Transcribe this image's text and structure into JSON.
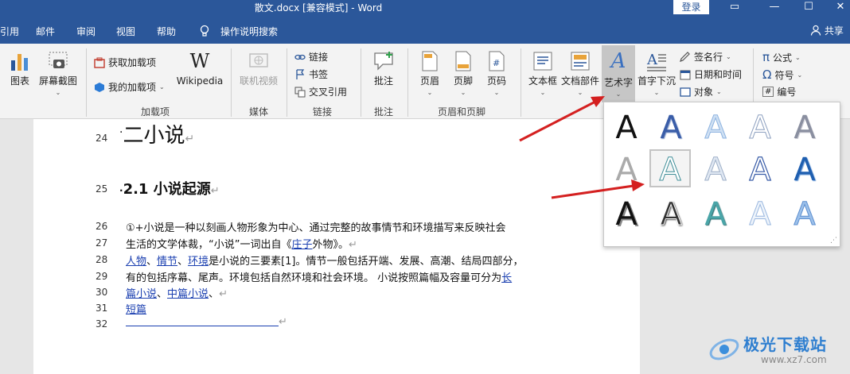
{
  "window": {
    "title": "散文.docx [兼容模式]  -  Word",
    "login": "登录",
    "btn_ribbon": "▭",
    "btn_min": "—",
    "btn_max": "☐",
    "btn_close": "✕"
  },
  "menu": {
    "items": [
      "引用",
      "邮件",
      "审阅",
      "视图",
      "帮助"
    ],
    "tell_me": "操作说明搜索",
    "share": "共享"
  },
  "ribbon": {
    "chart": "图表",
    "screenshot": "屏幕截图",
    "get_addins": "获取加载项",
    "my_addins": "我的加载项",
    "wikipedia": "Wikipedia",
    "addins_group": "加载项",
    "online_video": "联机视频",
    "media_group": "媒体",
    "link": "链接",
    "bookmark": "书签",
    "crossref": "交叉引用",
    "links_group": "链接",
    "comment": "批注",
    "comment_group": "批注",
    "header": "页眉",
    "footer": "页脚",
    "page_number": "页码",
    "hf_group": "页眉和页脚",
    "textbox": "文本框",
    "doc_parts": "文档部件",
    "wordart": "艺术字",
    "dropcap": "首字下沉",
    "sigline": "签名行",
    "datetime": "日期和时间",
    "object": "对象",
    "equation": "公式",
    "symbol": "符号",
    "numbering": "编号",
    "wordart_glyph": "A",
    "wiki_glyph": "W",
    "eq_glyph": "π",
    "sym_glyph": "Ω",
    "num_glyph": "#"
  },
  "document": {
    "line_numbers": [
      "24",
      "25",
      "26",
      "27",
      "28",
      "29",
      "30",
      "31",
      "32"
    ],
    "h1": "二小说",
    "h2": "2.1 小说起源",
    "p1": "①+小说是一种以刻画人物形象为中心、通过完整的故事情节和环境描写来反映社会",
    "p2a": "生活的文学体裁，“小说”一词出自《",
    "p2link": "庄子",
    "p2b": "外物》。",
    "p3l1": "人物",
    "p3s1": "、",
    "p3l2": "情节",
    "p3s2": "、",
    "p3l3": "环境",
    "p3b": "是小说的三要素[1]。情节一般包括开端、发展、高潮、结局四部分，",
    "p4a": "有的包括序幕、尾声。环境包括自然环境和社会环境。 小说按照篇幅及容量可分为",
    "p4link": "长",
    "p5link1": "篇小说",
    "p5s": "、",
    "p5link2": "中篇小说",
    "p5b": "、",
    "p6link": "短篇",
    "ret": "↵"
  },
  "gallery": {
    "glyph": "A",
    "count": 15,
    "selected": 6
  },
  "watermark": {
    "text": "极光下载站",
    "url": "www.xz7.com"
  },
  "colors": {
    "accent": "#2b579a",
    "link": "#1a3fb0",
    "arrow": "#d42020"
  }
}
